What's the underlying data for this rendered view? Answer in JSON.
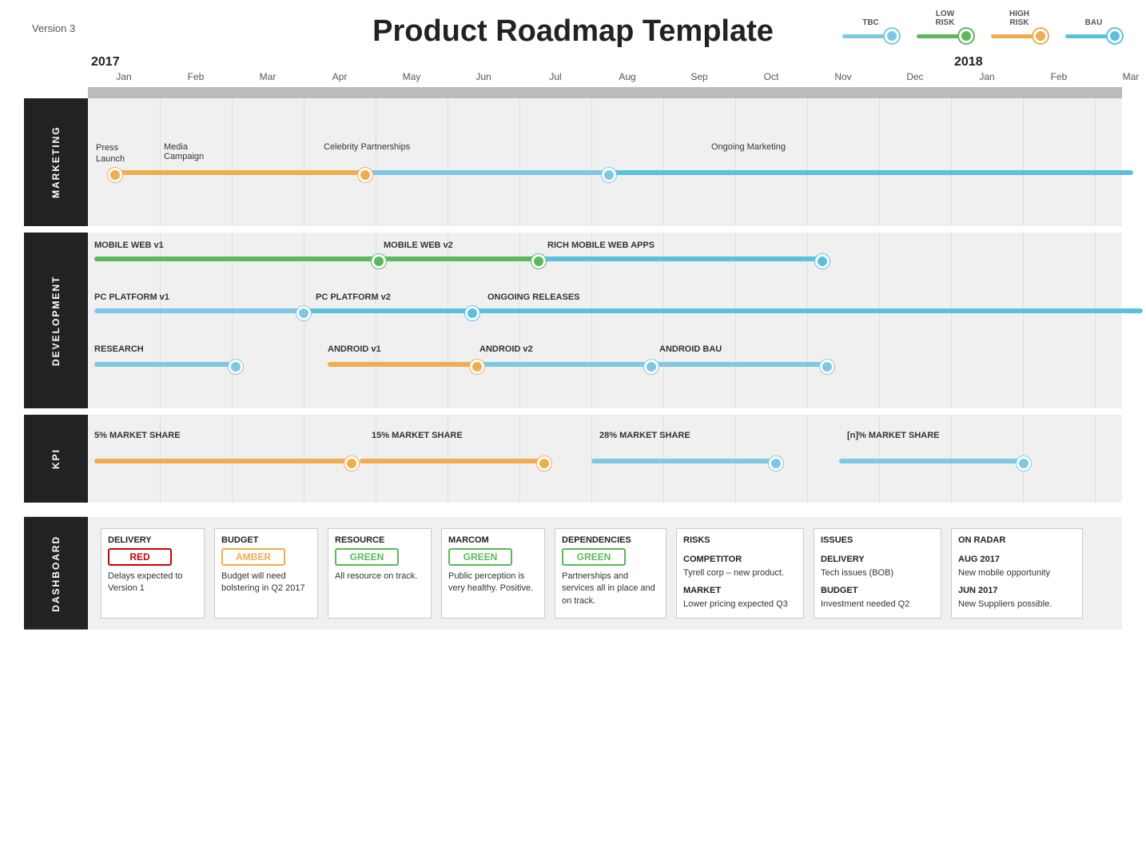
{
  "header": {
    "version": "Version 3",
    "title": "Product Roadmap Template"
  },
  "legend": {
    "items": [
      {
        "label": "TBC",
        "color": "#7ec8e3"
      },
      {
        "label": "LOW\nRISK",
        "color": "#5cb85c"
      },
      {
        "label": "HIGH\nRISK",
        "color": "#f0ad4e"
      },
      {
        "label": "BAU",
        "color": "#5bc0de"
      }
    ]
  },
  "timeline": {
    "years": [
      {
        "label": "2017",
        "months": [
          "Jan",
          "Feb",
          "Mar",
          "Apr",
          "May",
          "Jun",
          "Jul",
          "Aug",
          "Sep",
          "Oct",
          "Nov",
          "Dec"
        ]
      },
      {
        "label": "2018",
        "months": [
          "Jan",
          "Feb",
          "Mar"
        ]
      }
    ]
  },
  "sections": {
    "marketing": {
      "label": "MARKETING",
      "items": [
        {
          "name": "Press Launch",
          "type": "label"
        },
        {
          "name": "Media Campaign",
          "type": "bar",
          "color": "#f0ad4e"
        },
        {
          "name": "Celebrity Partnerships",
          "type": "bar",
          "color": "#7ec8e3"
        },
        {
          "name": "Ongoing Marketing",
          "type": "bar",
          "color": "#5bc0de"
        }
      ]
    },
    "development": {
      "label": "DEVELOPMENT",
      "items": [
        {
          "name": "MOBILE WEB v1",
          "type": "bar",
          "color": "#5cb85c"
        },
        {
          "name": "MOBILE WEB v2",
          "type": "bar",
          "color": "#5cb85c"
        },
        {
          "name": "RICH MOBILE WEB APPS",
          "type": "bar",
          "color": "#5bc0de"
        },
        {
          "name": "PC PLATFORM v1",
          "type": "bar",
          "color": "#7ec8e3"
        },
        {
          "name": "PC PLATFORM v2",
          "type": "bar",
          "color": "#5bc0de"
        },
        {
          "name": "ONGOING RELEASES",
          "type": "bar",
          "color": "#5bc0de"
        },
        {
          "name": "RESEARCH",
          "type": "bar",
          "color": "#7ec8e3"
        },
        {
          "name": "ANDROID v1",
          "type": "bar",
          "color": "#f0ad4e"
        },
        {
          "name": "ANDROID v2",
          "type": "bar",
          "color": "#7ec8e3"
        },
        {
          "name": "ANDROID BAU",
          "type": "bar",
          "color": "#7ec8e3"
        }
      ]
    },
    "kpi": {
      "label": "KPI",
      "items": [
        {
          "name": "5% MARKET SHARE"
        },
        {
          "name": "15% MARKET SHARE"
        },
        {
          "name": "28% MARKET SHARE"
        },
        {
          "name": "[n]% MARKET SHARE"
        }
      ]
    }
  },
  "dashboard": {
    "label": "DASHBOARD",
    "delivery": {
      "title": "DELIVERY",
      "status": "RED",
      "text": "Delays expected to Version 1"
    },
    "budget": {
      "title": "BUDGET",
      "status": "AMBER",
      "text": "Budget will need bolstering in Q2 2017"
    },
    "resource": {
      "title": "RESOURCE",
      "status": "GREEN",
      "text": "All resource on track."
    },
    "marcom": {
      "title": "MARCOM",
      "status": "GREEN",
      "text": "Public perception is very healthy. Positive."
    },
    "dependencies": {
      "title": "DEPENDENCIES",
      "status": "GREEN",
      "text": "Partnerships and services all in place and on track."
    },
    "risks": {
      "title": "RISKS",
      "items": [
        {
          "title": "COMPETITOR",
          "text": "Tyrell corp – new product."
        },
        {
          "title": "MARKET",
          "text": "Lower pricing expected Q3"
        }
      ]
    },
    "issues": {
      "title": "ISSUES",
      "items": [
        {
          "title": "DELIVERY",
          "text": "Tech issues (BOB)"
        },
        {
          "title": "BUDGET",
          "text": "Investment needed Q2"
        }
      ]
    },
    "onradar": {
      "title": "ON RADAR",
      "items": [
        {
          "title": "AUG 2017",
          "text": "New mobile opportunity"
        },
        {
          "title": "JUN 2017",
          "text": "New Suppliers possible."
        }
      ]
    }
  }
}
